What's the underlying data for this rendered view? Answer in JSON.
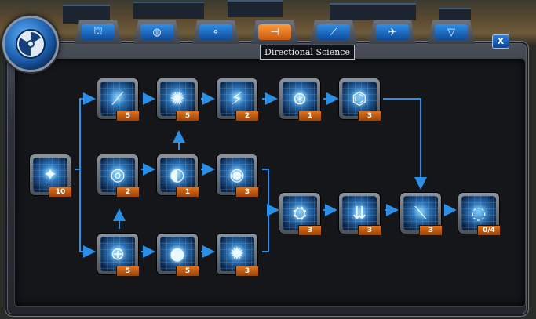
{
  "window": {
    "tooltip": "Directional Science",
    "close_label": "X"
  },
  "colors": {
    "accent": "#2b8fe8",
    "active_tab": "#e57a20",
    "count_badge": "#d06a18"
  },
  "tabs": [
    {
      "icon": "ground-unit-icon",
      "glyph": "⛫",
      "active": false
    },
    {
      "icon": "planet-icon",
      "glyph": "◍",
      "active": false
    },
    {
      "icon": "orbit-icon",
      "glyph": "⚬",
      "active": false
    },
    {
      "icon": "directional-science-icon",
      "glyph": "⊣",
      "active": true
    },
    {
      "icon": "missile-icon",
      "glyph": "⟋",
      "active": false
    },
    {
      "icon": "aircraft-icon",
      "glyph": "✈",
      "active": false
    },
    {
      "icon": "shield-icon",
      "glyph": "▽",
      "active": false
    }
  ],
  "nodes": [
    {
      "id": "root",
      "icon": "light-prism-icon",
      "glyph": "✦",
      "count": "10"
    },
    {
      "id": "r1c1",
      "icon": "beam-chain-icon",
      "glyph": "⟋",
      "count": "5"
    },
    {
      "id": "r1c2",
      "icon": "energy-burst-icon",
      "glyph": "✺",
      "count": "5"
    },
    {
      "id": "r1c3",
      "icon": "plasma-spark-icon",
      "glyph": "⚡",
      "count": "2"
    },
    {
      "id": "r1c4",
      "icon": "orbit-flash-icon",
      "glyph": "⊛",
      "count": "1"
    },
    {
      "id": "r1c5",
      "icon": "circuit-node-icon",
      "glyph": "⌬",
      "count": "3"
    },
    {
      "id": "r2c1",
      "icon": "target-cluster-icon",
      "glyph": "◎",
      "count": "2"
    },
    {
      "id": "r2c2",
      "icon": "planet-strike-icon",
      "glyph": "◐",
      "count": "1"
    },
    {
      "id": "r2c3",
      "icon": "radar-pulse-icon",
      "glyph": "◉",
      "count": "3"
    },
    {
      "id": "r3c1",
      "icon": "crosshair-icon",
      "glyph": "⊕",
      "count": "5"
    },
    {
      "id": "r3c2",
      "icon": "dark-orb-icon",
      "glyph": "●",
      "count": "5"
    },
    {
      "id": "r3c3",
      "icon": "nova-burst-icon",
      "glyph": "✹",
      "count": "3"
    },
    {
      "id": "m1",
      "icon": "drone-scan-icon",
      "glyph": "⛭",
      "count": "3"
    },
    {
      "id": "m2",
      "icon": "downlink-icon",
      "glyph": "⇊",
      "count": "3"
    },
    {
      "id": "m3",
      "icon": "laser-array-icon",
      "glyph": "⟍",
      "count": "3"
    },
    {
      "id": "m4",
      "icon": "vortex-icon",
      "glyph": "◌",
      "count": "0/4"
    }
  ]
}
